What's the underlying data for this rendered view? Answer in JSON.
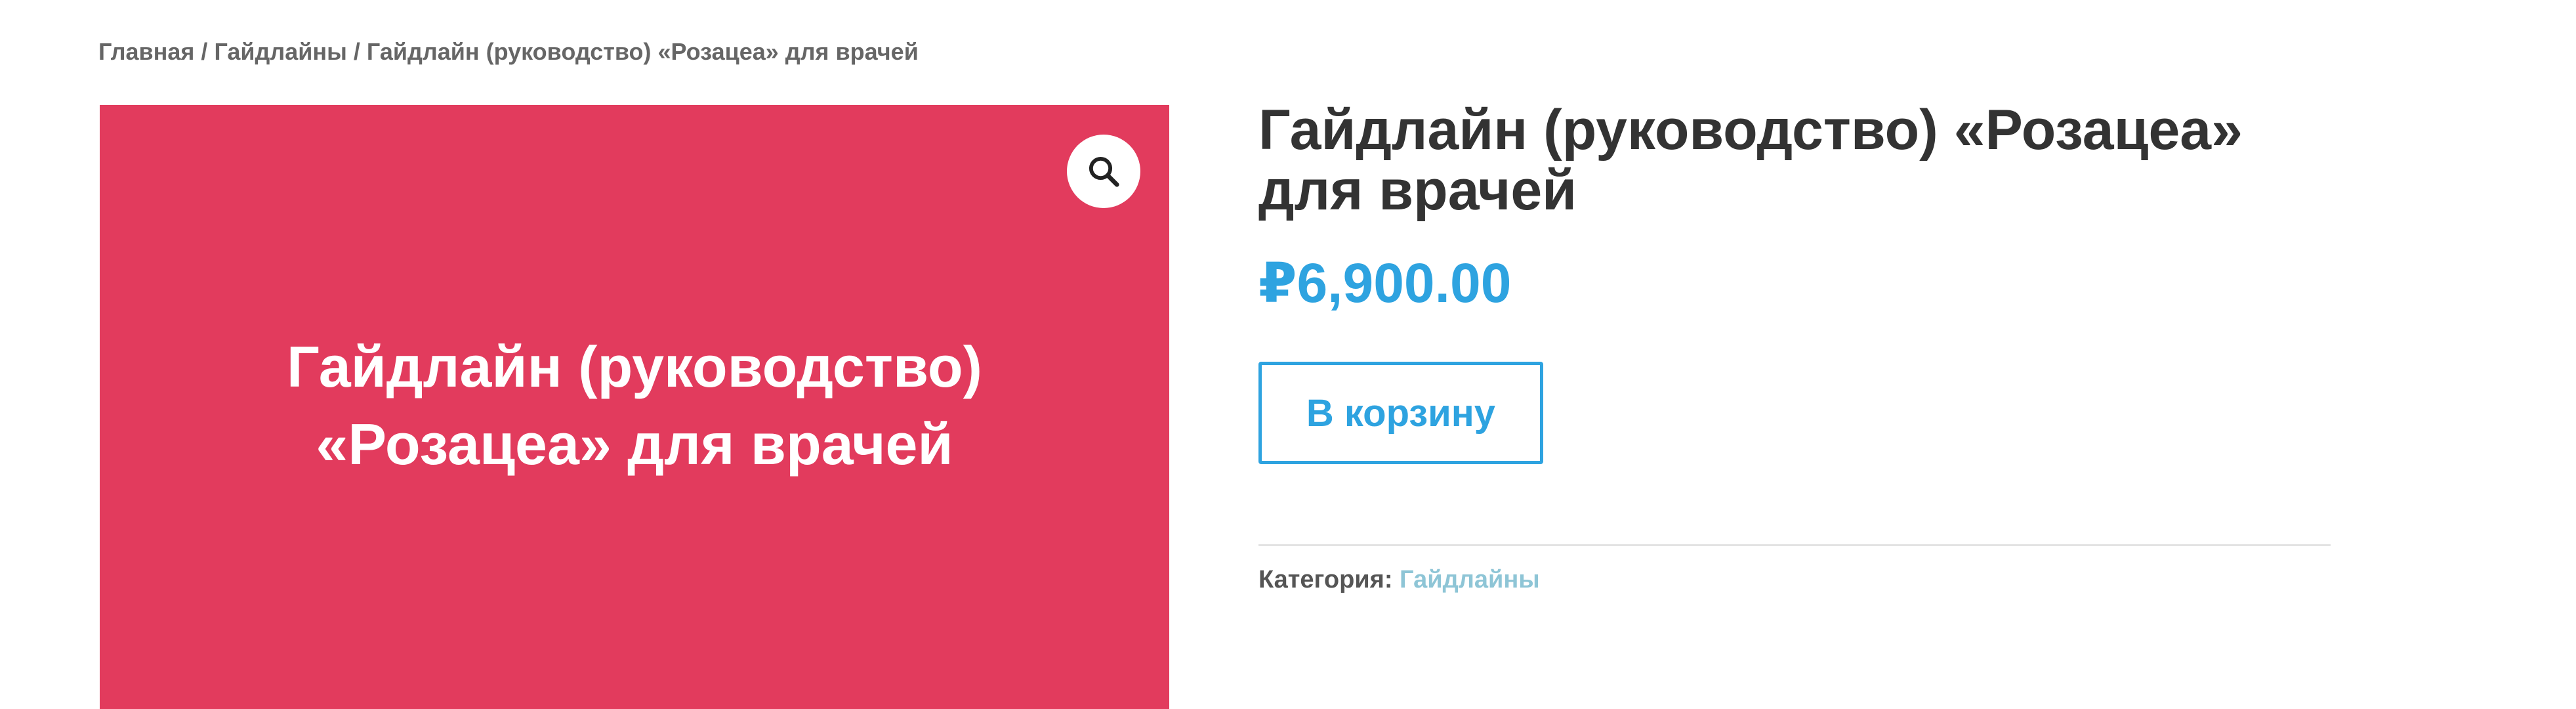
{
  "breadcrumb": {
    "items": [
      "Главная",
      "Гайдлайны",
      "Гайдлайн (руководство) «Розацеа» для врачей"
    ],
    "separator": "/"
  },
  "image": {
    "title_line1": "Гайдлайн (руководство)",
    "title_line2": "«Розацеа» для врачей",
    "background_color": "#e23b5d",
    "zoom_icon": "magnifier-icon"
  },
  "product": {
    "title": "Гайдлайн (руководство) «Розацеа» для врачей",
    "price": "₽6,900.00",
    "add_to_cart_label": "В корзину",
    "category_label": "Категория:",
    "category_value": "Гайдлайны"
  },
  "colors": {
    "accent": "#2ea3e0",
    "category_link": "#8ec5d6",
    "text": "#333333"
  }
}
